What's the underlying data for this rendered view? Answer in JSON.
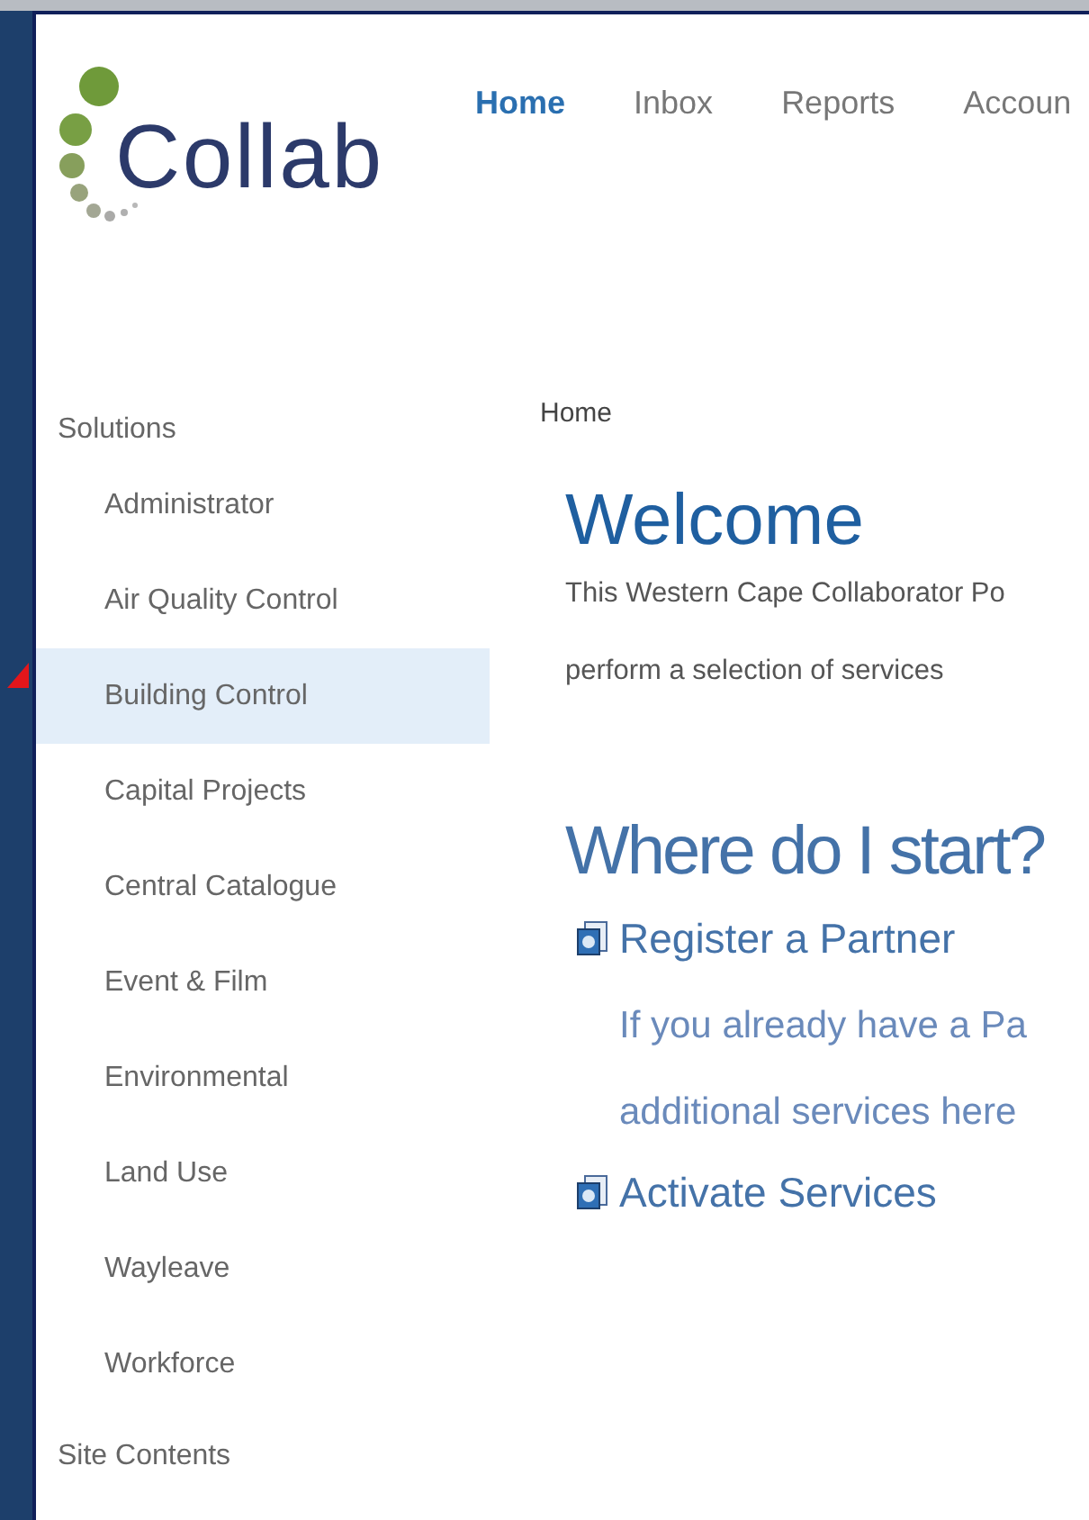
{
  "logo": {
    "text": "Collab"
  },
  "nav": [
    {
      "label": "Home",
      "selected": true
    },
    {
      "label": "Inbox",
      "selected": false
    },
    {
      "label": "Reports",
      "selected": false
    },
    {
      "label": "Accoun",
      "selected": false
    }
  ],
  "sidebar": {
    "heading": "Solutions",
    "items": [
      {
        "label": "Administrator",
        "selected": false
      },
      {
        "label": "Air Quality Control",
        "selected": false
      },
      {
        "label": "Building Control",
        "selected": true
      },
      {
        "label": "Capital Projects",
        "selected": false
      },
      {
        "label": "Central Catalogue",
        "selected": false
      },
      {
        "label": "Event & Film",
        "selected": false
      },
      {
        "label": "Environmental",
        "selected": false
      },
      {
        "label": "Land Use",
        "selected": false
      },
      {
        "label": "Wayleave",
        "selected": false
      },
      {
        "label": "Workforce",
        "selected": false
      }
    ],
    "footer": "Site Contents"
  },
  "breadcrumb": "Home",
  "welcome": {
    "title": "Welcome",
    "lines": [
      "This Western Cape Collaborator Po",
      "perform a selection of services"
    ]
  },
  "start": {
    "title": "Where do I start?",
    "links": [
      {
        "label": "Register a Partner",
        "description": [
          "If you already have a Pa",
          "additional services here"
        ]
      },
      {
        "label": "Activate Services"
      }
    ]
  }
}
